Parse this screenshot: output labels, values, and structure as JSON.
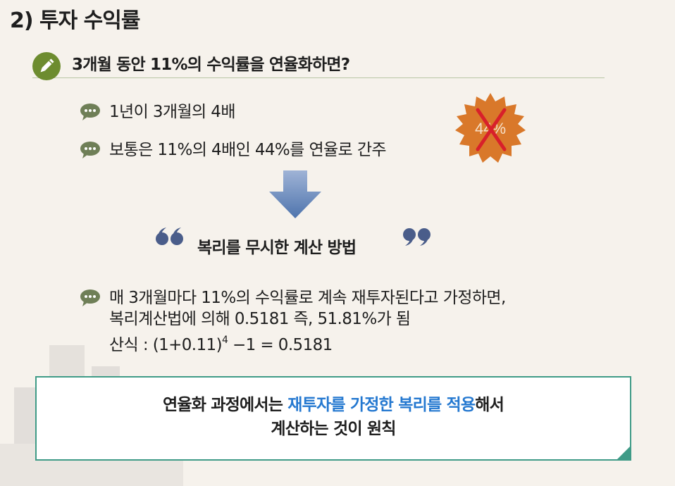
{
  "page": {
    "title": "2) 투자 수익률"
  },
  "question": {
    "text": "3개월 동안 11%의 수익률을 연율화하면?"
  },
  "simple_method": {
    "bullets": [
      "1년이 3개월의 4배",
      "보통은 11%의 4배인 44%를 연율로 간주"
    ],
    "stamp_value": "44%"
  },
  "compound_method": {
    "heading": "복리를 무시한 계산 방법",
    "line1": "매 3개월마다 11%의 수익률로 계속 재투자된다고 가정하면,",
    "line2": "복리계산법에 의해 0.5181 즉, 51.81%가 됨",
    "formula_prefix": "산식 : (1+0.11)",
    "formula_exponent": "4",
    "formula_suffix": " −1 = 0.5181"
  },
  "conclusion": {
    "part1": "연율화 과정에서는 ",
    "highlight": "재투자를 가정한 복리를 적용",
    "part2": "해서",
    "line2": "계산하는 것이 원칙"
  },
  "colors": {
    "accent_green": "#6d8c2f",
    "bubble_green": "#6f7f57",
    "stamp_orange": "#d9782a",
    "cross_red": "#d8202a",
    "highlight_blue": "#2478d0",
    "box_border": "#3f9b87",
    "arrow_blue": "#5a7fb5"
  },
  "icons": {
    "question": "pencil-icon",
    "bullet": "speech-bubble-icon",
    "stamp": "cross-mark-icon",
    "arrow": "down-arrow-icon",
    "quote": "quote-icon"
  }
}
